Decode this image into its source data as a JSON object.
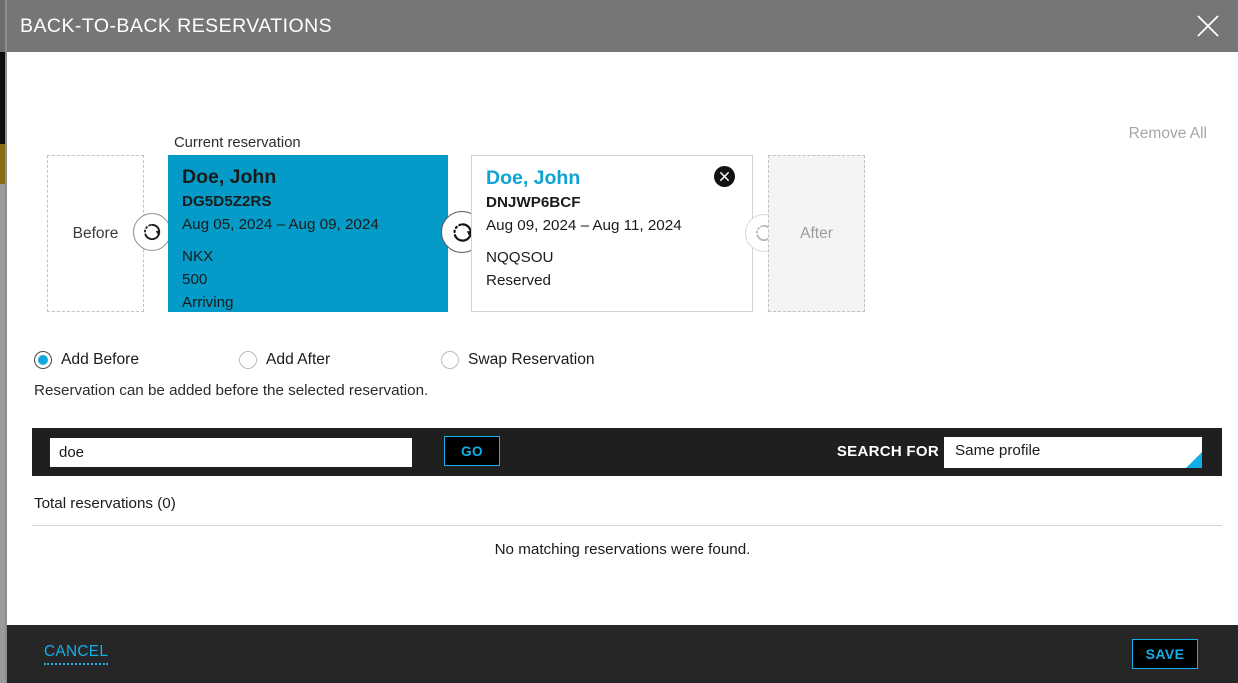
{
  "titlebar": {
    "title": "BACK-TO-BACK RESERVATIONS",
    "close_icon": "close-icon"
  },
  "body": {
    "remove_all_label": "Remove All",
    "current_reservation_label": "Current reservation",
    "before_placeholder": "Before",
    "after_placeholder": "After",
    "swap_icon": "swap-reservation-icon",
    "cards": [
      {
        "name": "Doe, John",
        "confirmation": "DG5D5Z2RS",
        "dates": "Aug 05, 2024 – Aug 09, 2024",
        "room_type": "NKX",
        "room_number": "500",
        "status": "Arriving",
        "selected": true,
        "removable": false
      },
      {
        "name": "Doe, John",
        "confirmation": "DNJWP6BCF",
        "dates": "Aug 09, 2024 – Aug 11, 2024",
        "room_type": "NQQSOU",
        "room_number": "",
        "status": "Reserved",
        "selected": false,
        "removable": true,
        "remove_icon": "remove-circle-icon"
      }
    ],
    "radios": [
      {
        "label": "Add Before",
        "selected": true
      },
      {
        "label": "Add After",
        "selected": false
      },
      {
        "label": "Swap Reservation",
        "selected": false
      }
    ],
    "hint": "Reservation can be added before the selected reservation.",
    "search": {
      "value": "doe",
      "placeholder": "",
      "go_label": "GO",
      "search_for_label": "SEARCH FOR",
      "selected_option": "Same profile",
      "options": [
        "Same profile"
      ]
    },
    "results": {
      "total_label": "Total reservations (0)",
      "empty_message": "No matching reservations were found."
    }
  },
  "footer": {
    "cancel_label": "CANCEL",
    "save_label": "SAVE"
  },
  "colors": {
    "accent_cyan": "#12b0e8",
    "card_selected": "#049bc8",
    "titlebar_gray": "#767676",
    "footer_dark": "#262626",
    "searchbar_dark": "#1f1f1f"
  }
}
